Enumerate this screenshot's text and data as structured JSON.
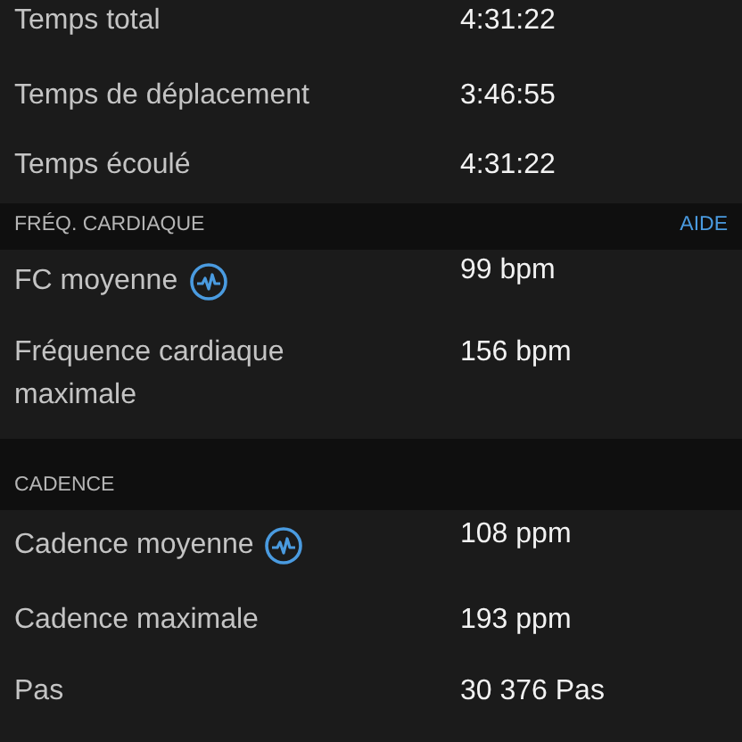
{
  "sections": [
    {
      "rows": [
        {
          "label": "Temps total",
          "value": "4:31:22",
          "has_icon": false
        },
        {
          "label": "Temps de déplacement",
          "value": "3:46:55",
          "has_icon": false
        },
        {
          "label": "Temps écoulé",
          "value": "4:31:22",
          "has_icon": false
        }
      ]
    },
    {
      "title": "FRÉQ. CARDIAQUE",
      "link": "AIDE",
      "rows": [
        {
          "label": "FC moyenne",
          "value": "99 bpm",
          "has_icon": true
        },
        {
          "label": "Fréquence cardiaque maximale",
          "value": "156 bpm",
          "has_icon": false
        }
      ]
    },
    {
      "title": "CADENCE",
      "rows": [
        {
          "label": "Cadence moyenne",
          "value": "108 ppm",
          "has_icon": true
        },
        {
          "label": "Cadence maximale",
          "value": "193 ppm",
          "has_icon": false
        },
        {
          "label": "Pas",
          "value": "30 376 Pas",
          "has_icon": false
        }
      ]
    }
  ]
}
